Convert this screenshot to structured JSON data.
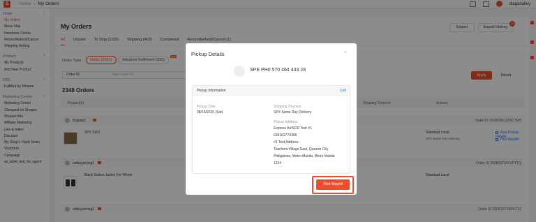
{
  "topbar": {
    "home": "Home",
    "current": "My Orders",
    "username": "diaganalley",
    "logo_letter": "S"
  },
  "sidebar": [
    {
      "header": "Order",
      "items": [
        "My Orders",
        "Mass Ship",
        "Handover Centre",
        "Return/Refund/Cancel",
        "Shipping Setting"
      ]
    },
    {
      "header": "Product",
      "items": [
        "My Products",
        "Add New Product"
      ]
    },
    {
      "header": "FBS",
      "items": [
        "Fulfilled by Shopee"
      ]
    },
    {
      "header": "Marketing Centre",
      "items": [
        "Marketing Centre",
        "Cheapest on Shopee",
        "Shopee Ads",
        "Affiliate Marketing",
        "Live & Video",
        "Discount",
        "My Shop's Flash Deals",
        "Vouchers",
        "Campaign",
        "sa_label_test_for_agent"
      ]
    }
  ],
  "main": {
    "title": "My Orders",
    "export_label": "Export",
    "export_history_label": "Export History",
    "export_history_badge": "10",
    "tabs": [
      "All",
      "Unpaid",
      "To Ship (1105)",
      "Shipping (403)",
      "Completed",
      "Return/Refund/Cancel (1)"
    ],
    "order_type_label": "Order Type",
    "order_type_options": [
      "Order (2581)",
      "Advance Fulfilment (320)"
    ],
    "new_badge": "New",
    "filter_field": "Order ID",
    "filter_placeholder": "Input order ID",
    "apply_label": "Apply",
    "reset_label": "Reset",
    "count": "2348 Orders",
    "columns": [
      "Product(s)",
      "Shipping Channel",
      "Actions"
    ],
    "orders": [
      {
        "user": "lingaap2",
        "order_id": "Order ID 250815BJ12NC7MY",
        "product": "SPX SDD",
        "shipping": "Standard Local",
        "shipping_sub": "SPX Same Day Delivery",
        "actions": [
          "View Pickup Details",
          "Print Waybill"
        ]
      },
      {
        "user": "ustbuyer.bsg1",
        "order_id": "Order ID 250815TWXVFYTQ",
        "product": "Black Cotton Jacket For Winter",
        "shipping": "Standard Local",
        "shipping_sub": "",
        "actions": []
      },
      {
        "user": "ustbuyer.bsg1",
        "order_id": "Order ID 250815TS5PK1Y2",
        "product": "",
        "shipping": "",
        "shipping_sub": "",
        "actions": []
      }
    ]
  },
  "modal": {
    "title": "Pickup Details",
    "close": "×",
    "tracking": "SPE PH0 570 464 443 28",
    "section_title": "Pickup Information",
    "edit_label": "Edit",
    "pickup_date_label": "Pickup Date",
    "pickup_date": "08/16/2025 (Sat)",
    "channel_label": "Shipping Channel",
    "channel": "SPX Same Day Delivery",
    "address_label": "Pickup Address",
    "address_lines": [
      "Express Air/SDD Test #1",
      "639162773366",
      "#1 Test Address",
      "Teachers Village East, Quezon City",
      "Philippines, Metro Manila, Metro Manila",
      "1234"
    ],
    "print_label": "Print Waybill"
  }
}
